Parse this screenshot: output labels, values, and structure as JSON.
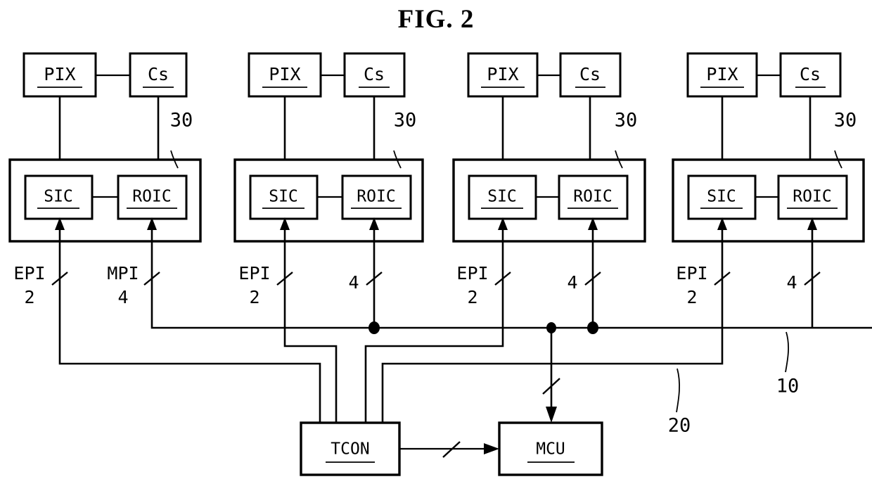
{
  "figure": {
    "title": "FIG. 2",
    "type": "patent-block-diagram"
  },
  "columns": [
    {
      "index": 0,
      "pix_label": "PIX",
      "cs_label": "Cs",
      "panel_ref": "30",
      "sic_label": "SIC",
      "roic_label": "ROIC",
      "sic_bus_name": "EPI",
      "sic_bus_width": "2",
      "roic_bus_name": "MPI",
      "roic_bus_width": "4"
    },
    {
      "index": 1,
      "pix_label": "PIX",
      "cs_label": "Cs",
      "panel_ref": "30",
      "sic_label": "SIC",
      "roic_label": "ROIC",
      "sic_bus_name": "EPI",
      "sic_bus_width": "2",
      "roic_bus_name": "",
      "roic_bus_width": "4"
    },
    {
      "index": 2,
      "pix_label": "PIX",
      "cs_label": "Cs",
      "panel_ref": "30",
      "sic_label": "SIC",
      "roic_label": "ROIC",
      "sic_bus_name": "EPI",
      "sic_bus_width": "2",
      "roic_bus_name": "",
      "roic_bus_width": "4"
    },
    {
      "index": 3,
      "pix_label": "PIX",
      "cs_label": "Cs",
      "panel_ref": "30",
      "sic_label": "SIC",
      "roic_label": "ROIC",
      "sic_bus_name": "EPI",
      "sic_bus_width": "2",
      "roic_bus_name": "",
      "roic_bus_width": "4"
    }
  ],
  "controllers": {
    "tcon_label": "TCON",
    "mcu_label": "MCU"
  },
  "reference_numerals": {
    "panel_module": "30",
    "mpi_bus": "10",
    "epi_bus": "20"
  },
  "colors": {
    "line": "#000000",
    "background": "#ffffff"
  }
}
